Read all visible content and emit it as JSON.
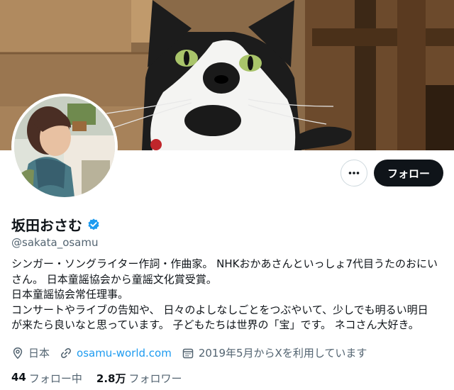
{
  "profile": {
    "display_name": "坂田おさむ",
    "handle": "@sakata_osamu",
    "verified": true,
    "bio_lines": [
      "シンガー・ソングライター作詞・作曲家。 NHKおかあさんといっしょ7代目うたのおにい",
      "さん。 日本童謡協会から童謡文化賞受賞。",
      "日本童謡協会常任理事。",
      "コンサートやライブの告知や、 日々のよしなしごとをつぶやいて、少しでも明るい明日",
      "が来たら良いなと思っています。 子どもたちは世界の「宝」です。 ネコさん大好き。"
    ],
    "location": "日本",
    "website": "osamu-world.com",
    "joined": "2019年5月からXを利用しています"
  },
  "stats": {
    "following_count": "44",
    "following_label": "フォロー中",
    "followers_count": "2.8万",
    "followers_label": "フォロワー"
  },
  "actions": {
    "follow_label": "フォロー",
    "more_icon": "more-horizontal-icon"
  },
  "colors": {
    "accent": "#1d9bf0",
    "text": "#0f1419",
    "secondary_text": "#536471",
    "button_dark": "#0f1419"
  }
}
